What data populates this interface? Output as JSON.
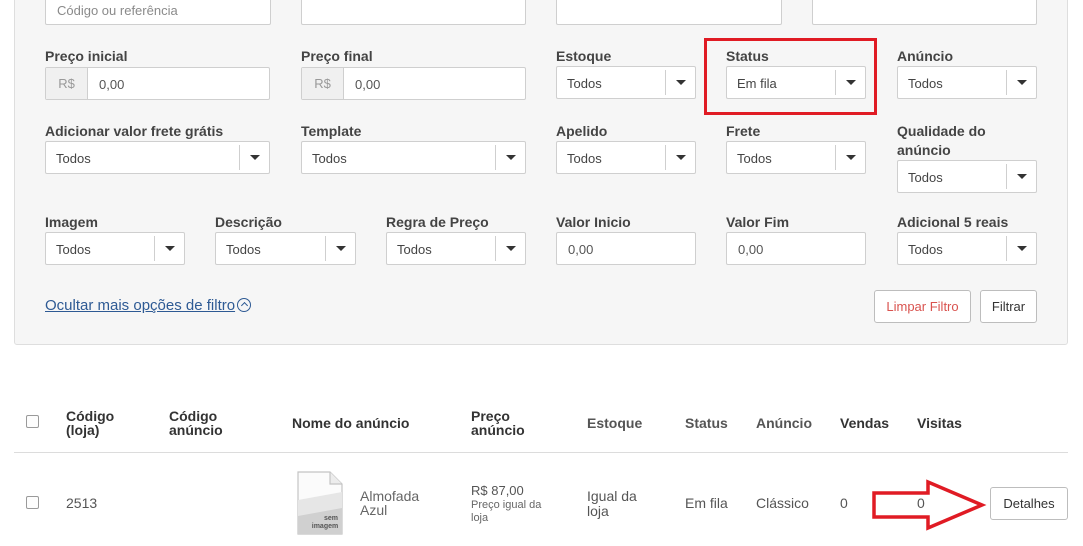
{
  "filters": {
    "row0": {
      "codigo_placeholder": "Código ou referência"
    },
    "preco_inicial": {
      "label": "Preço inicial",
      "prefix": "R$",
      "placeholder": "0,00"
    },
    "preco_final": {
      "label": "Preço final",
      "prefix": "R$",
      "placeholder": "0,00"
    },
    "estoque": {
      "label": "Estoque",
      "value": "Todos"
    },
    "status": {
      "label": "Status",
      "value": "Em fila"
    },
    "anuncio": {
      "label": "Anúncio",
      "value": "Todos"
    },
    "adicionar_frete": {
      "label": "Adicionar valor frete grátis",
      "value": "Todos"
    },
    "template": {
      "label": "Template",
      "value": "Todos"
    },
    "apelido": {
      "label": "Apelido",
      "value": "Todos"
    },
    "frete": {
      "label": "Frete",
      "value": "Todos"
    },
    "qualidade": {
      "label_line1": "Qualidade do",
      "label_line2": "anúncio",
      "value": "Todos"
    },
    "imagem": {
      "label": "Imagem",
      "value": "Todos"
    },
    "descricao": {
      "label": "Descrição",
      "value": "Todos"
    },
    "regra_preco": {
      "label": "Regra de Preço",
      "value": "Todos"
    },
    "valor_inicio": {
      "label": "Valor Inicio",
      "placeholder": "0,00"
    },
    "valor_fim": {
      "label": "Valor Fim",
      "placeholder": "0,00"
    },
    "adicional": {
      "label": "Adicional 5 reais",
      "value": "Todos"
    },
    "toggle_link": "Ocultar mais opções de filtro",
    "clear_label": "Limpar Filtro",
    "filter_label": "Filtrar"
  },
  "table": {
    "headers": {
      "codigo_loja_1": "Código",
      "codigo_loja_2": "(loja)",
      "codigo_anuncio_1": "Código",
      "codigo_anuncio_2": "anúncio",
      "nome": "Nome do anúncio",
      "preco_1": "Preço",
      "preco_2": "anúncio",
      "estoque": "Estoque",
      "status": "Status",
      "anuncio": "Anúncio",
      "vendas": "Vendas",
      "visitas": "Visitas"
    },
    "rows": [
      {
        "codigo_loja": "2513",
        "thumb_line1": "sem",
        "thumb_line2": "imagem",
        "nome_1": "Almofada",
        "nome_2": "Azul",
        "preco": "R$ 87,00",
        "preco_note_1": "Preço igual da",
        "preco_note_2": "loja",
        "estoque_1": "Igual da",
        "estoque_2": "loja",
        "status": "Em fila",
        "anuncio": "Clássico",
        "vendas": "0",
        "visitas": "0",
        "details_label": "Detalhes"
      }
    ]
  },
  "colors": {
    "highlight": "#e01b24",
    "link": "#2e5a94",
    "clear_button_text": "#d9534f"
  }
}
